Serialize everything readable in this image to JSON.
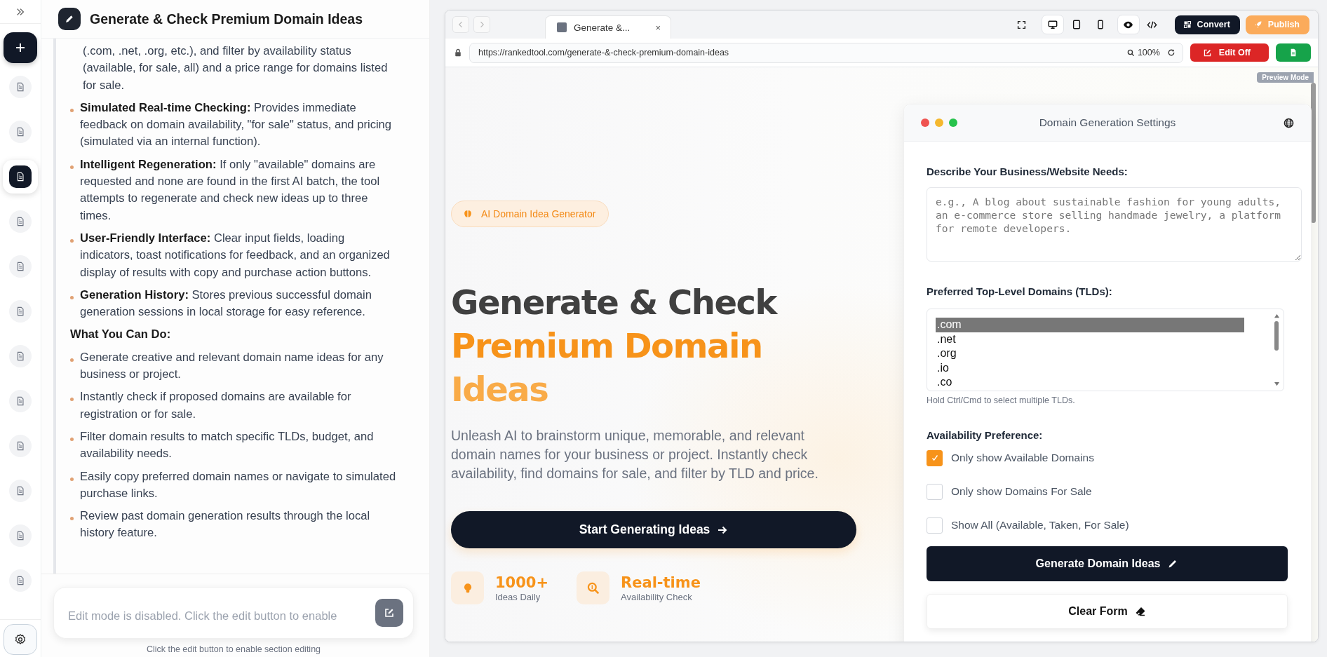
{
  "rail": {
    "documents": [
      {
        "selected": false
      },
      {
        "selected": false
      },
      {
        "selected": true
      },
      {
        "selected": false
      },
      {
        "selected": false
      },
      {
        "selected": false
      },
      {
        "selected": false
      },
      {
        "selected": false
      },
      {
        "selected": false
      },
      {
        "selected": false
      },
      {
        "selected": false
      },
      {
        "selected": false
      }
    ]
  },
  "panel": {
    "title": "Generate & Check Premium Domain Ideas",
    "continued_text": "(.com, .net, .org, etc.), and filter by availability status (available, for sale, all) and a price range for domains listed for sale.",
    "features": [
      "**Simulated Real-time Checking:** Provides immediate feedback on domain availability, \"for sale\" status, and pricing (simulated via an internal function).",
      "**Intelligent Regeneration:** If only \"available\" domains are requested and none are found in the first AI batch, the tool attempts to regenerate and check new ideas up to three times.",
      "**User-Friendly Interface:** Clear input fields, loading indicators, toast notifications for feedback, and an organized display of results with copy and purchase action buttons.",
      "**Generation History:** Stores previous successful domain generation sessions in local storage for easy reference."
    ],
    "section_heading": "What You Can Do:",
    "can_do": [
      "Generate creative and relevant domain name ideas for any business or project.",
      "Instantly check if proposed domains are available for registration or for sale.",
      "Filter domain results to match specific TLDs, budget, and availability needs.",
      "Easily copy preferred domain names or navigate to simulated purchase links.",
      "Review past domain generation results through the local history feature."
    ]
  },
  "editor": {
    "placeholder": "Edit mode is disabled. Click the edit button to enable",
    "disabled": true,
    "hint": "Click the edit button to enable section editing"
  },
  "browser": {
    "tab": {
      "title": "Generate &...",
      "close": "×"
    },
    "devices": [
      {
        "selected": true
      },
      {
        "selected": false
      },
      {
        "selected": false
      }
    ],
    "modes": [
      {
        "selected": true
      },
      {
        "selected": false
      }
    ],
    "convert": "Convert",
    "publish": "Publish",
    "url": "https://rankedtool.com/generate-&-check-premium-domain-ideas",
    "zoom": "100%",
    "edit_button": "Edit Off",
    "badge": "Preview Mode"
  },
  "hero": {
    "badge": "AI Domain Idea Generator",
    "title_lines": [
      {
        "text": "Generate & Check",
        "kind": "dark"
      },
      {
        "text": "Premium Domain",
        "kind": "accent"
      },
      {
        "text": "Ideas",
        "kind": "accent_soft"
      }
    ],
    "description": "Unleash AI to brainstorm unique, memorable, and relevant domain names for your business or project. Instantly check availability, find domains for sale, and filter by TLD and price.",
    "cta": "Start Generating Ideas",
    "stats": [
      {
        "value": "1000+",
        "label": "Ideas Daily"
      },
      {
        "value": "Real-time",
        "label": "Availability Check"
      }
    ]
  },
  "settings": {
    "title": "Domain Generation Settings",
    "needs_label": "Describe Your Business/Website Needs:",
    "needs_placeholder": "e.g., A blog about sustainable fashion for young adults, an e-commerce store selling handmade jewelry, a platform for remote developers.",
    "tld_label": "Preferred Top-Level Domains (TLDs):",
    "tlds": [
      {
        "label": ".com",
        "selected": true
      },
      {
        "label": ".net",
        "selected": false
      },
      {
        "label": ".org",
        "selected": false
      },
      {
        "label": ".io",
        "selected": false
      },
      {
        "label": ".co",
        "selected": false
      }
    ],
    "tld_hint": "Hold Ctrl/Cmd to select multiple TLDs.",
    "availability_label": "Availability Preference:",
    "availability": [
      {
        "label": "Only show Available Domains",
        "checked": true
      },
      {
        "label": "Only show Domains For Sale",
        "checked": false
      },
      {
        "label": "Show All (Available, Taken, For Sale)",
        "checked": false
      }
    ],
    "generate": "Generate Domain Ideas",
    "clear": "Clear Form"
  }
}
